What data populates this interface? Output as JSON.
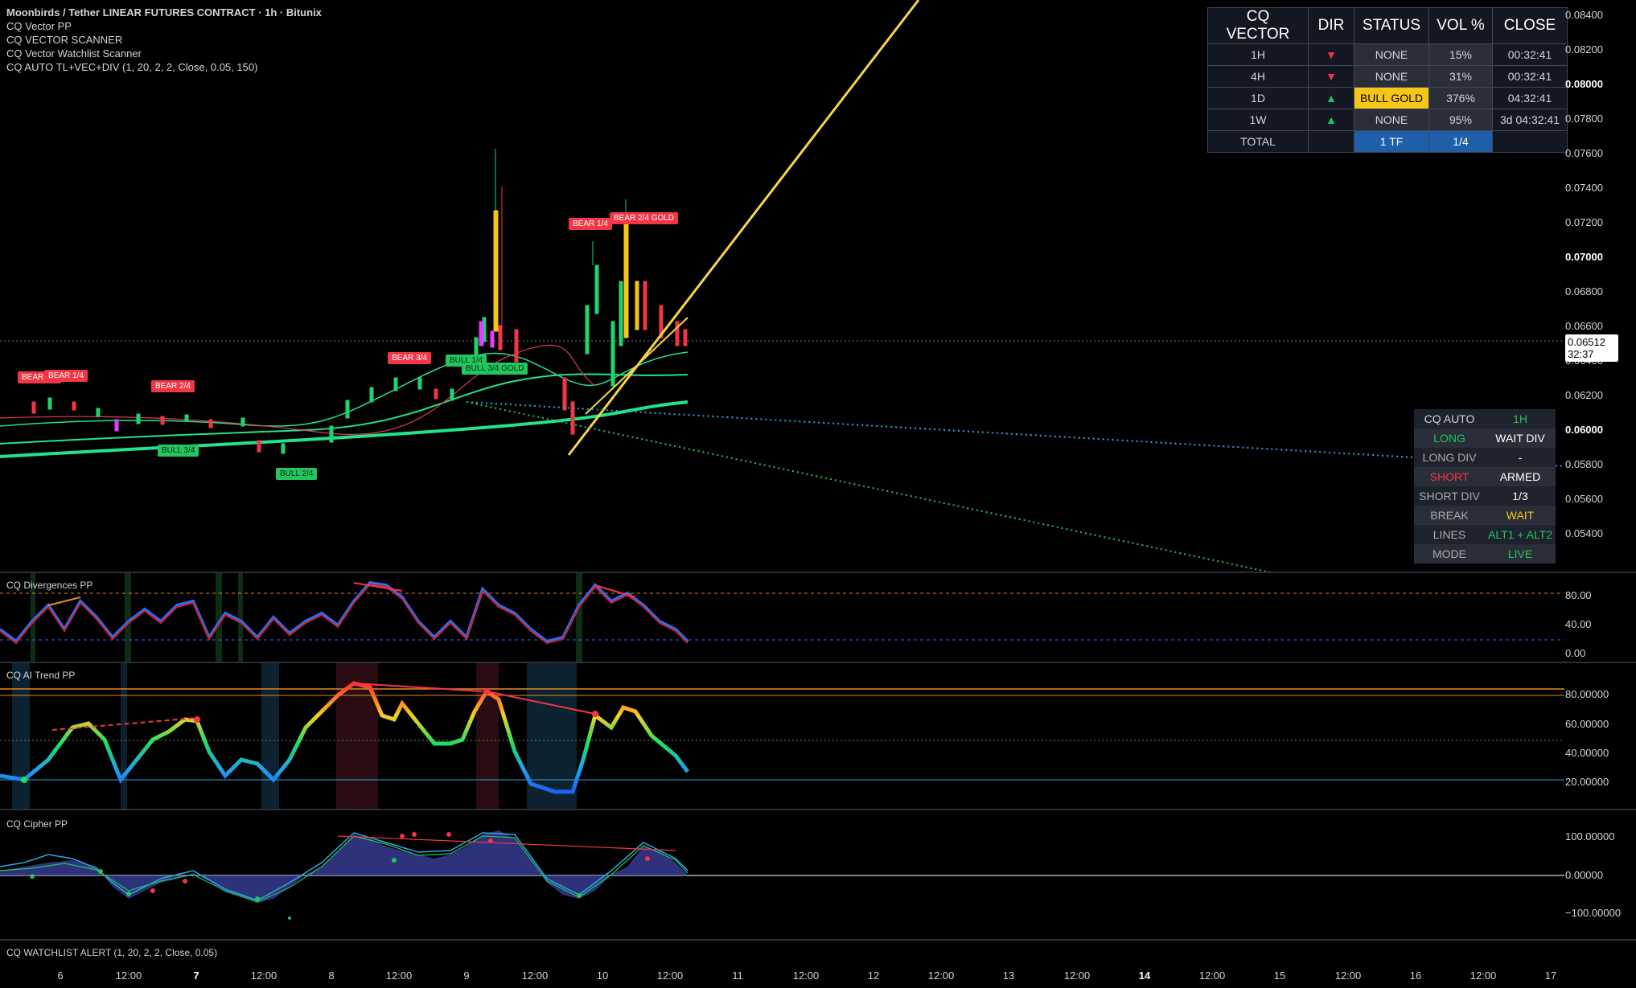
{
  "main_legend": {
    "symbol": "Moonbirds / Tether LINEAR FUTURES CONTRACT · 1h · Bitunix",
    "indicators": [
      "CQ Vector PP",
      "CQ VECTOR SCANNER",
      "CQ Vector Watchlist Scanner",
      "CQ AUTO TL+VEC+DIV (1, 20, 2, 2, Close, 0.05, 150)"
    ]
  },
  "price_axis": {
    "ticks": [
      "0.08400",
      "0.08200",
      "0.08000",
      "0.07800",
      "0.07600",
      "0.07400",
      "0.07200",
      "0.07000",
      "0.06800",
      "0.06600",
      "0.06400",
      "0.06200",
      "0.06000",
      "0.05800",
      "0.05600",
      "0.05400"
    ],
    "current_price": "0.06512",
    "countdown": "32:37"
  },
  "vector_table": {
    "headers": [
      "CQ VECTOR",
      "DIR",
      "STATUS",
      "VOL %",
      "CLOSE"
    ],
    "rows": [
      {
        "tf": "1H",
        "dir": "▼",
        "status": "NONE",
        "vol": "15%",
        "close": "00:32:41"
      },
      {
        "tf": "4H",
        "dir": "▼",
        "status": "NONE",
        "vol": "31%",
        "close": "00:32:41"
      },
      {
        "tf": "1D",
        "dir": "▲",
        "status": "BULL GOLD",
        "vol": "376%",
        "close": "04:32:41"
      },
      {
        "tf": "1W",
        "dir": "▲",
        "status": "NONE",
        "vol": "95%",
        "close": "3d 04:32:41"
      }
    ],
    "total": {
      "label": "TOTAL",
      "tf": "1 TF",
      "ratio": "1/4"
    }
  },
  "auto_panel": {
    "rows": [
      {
        "k": "CQ AUTO",
        "v": "1H"
      },
      {
        "k": "LONG",
        "v": "WAIT DIV"
      },
      {
        "k": "LONG DIV",
        "v": "-"
      },
      {
        "k": "SHORT",
        "v": "ARMED"
      },
      {
        "k": "SHORT DIV",
        "v": "1/3"
      },
      {
        "k": "BREAK",
        "v": "WAIT"
      },
      {
        "k": "LINES",
        "v": "ALT1 + ALT2"
      },
      {
        "k": "MODE",
        "v": "LIVE"
      }
    ]
  },
  "signal_tags": {
    "bear_a": "BEAR 1/4",
    "bear_a2": "BEAR 1/4",
    "bear_b": "BEAR 2/4",
    "bear_c": "BEAR 3/4",
    "bear_d": "BEAR 1/4",
    "bear_e": "BEAR 2/4 GOLD",
    "bull_a": "BULL 3/4",
    "bull_b": "BULL 2/4",
    "bull_c": "BULL 1/4",
    "bull_d": "BULL 3/4 GOLD"
  },
  "panes": {
    "divergences": {
      "title": "CQ Divergences PP",
      "ticks": [
        "80.00",
        "40.00",
        "0.00"
      ]
    },
    "ai_trend": {
      "title": "CQ AI Trend PP",
      "ticks": [
        "80.00000",
        "60.00000",
        "40.00000",
        "20.00000"
      ]
    },
    "cipher": {
      "title": "CQ Cipher PP",
      "ticks": [
        "100.00000",
        "0.00000",
        "−100.00000"
      ]
    },
    "watchlist": {
      "title": "CQ WATCHLIST ALERT (1, 20, 2, 2, Close, 0.05)"
    }
  },
  "time_axis": [
    "6",
    "12:00",
    "7",
    "12:00",
    "8",
    "12:00",
    "9",
    "12:00",
    "10",
    "12:00",
    "11",
    "12:00",
    "12",
    "12:00",
    "13",
    "12:00",
    "14",
    "12:00",
    "15",
    "12:00",
    "16",
    "12:00",
    "17"
  ],
  "colors": {
    "bear": "#f23645",
    "bull": "#22c55e",
    "gold": "#f5c518",
    "trendline": "#f7d54a"
  }
}
